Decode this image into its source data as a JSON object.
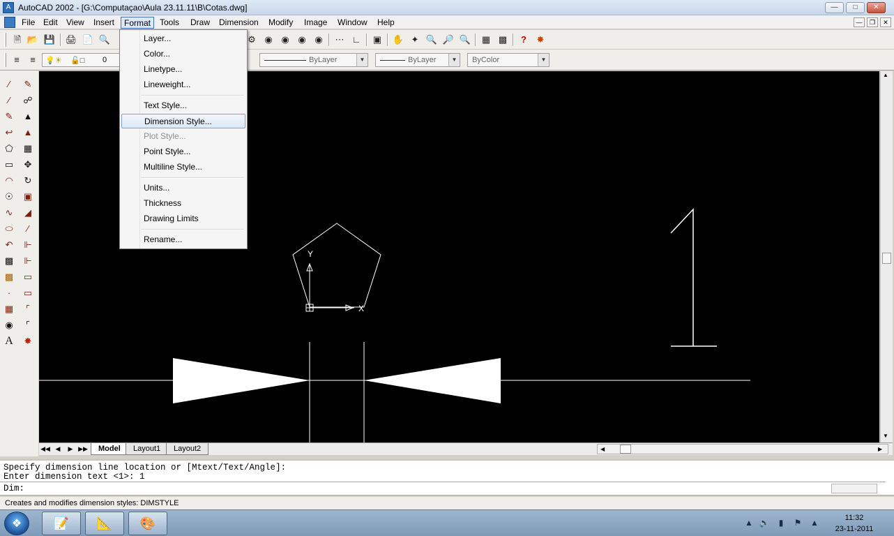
{
  "window": {
    "title": "AutoCAD 2002 - [G:\\Computaçao\\Aula 23.11.11\\B\\Cotas.dwg]",
    "controls": [
      "minimize",
      "maximize",
      "close"
    ]
  },
  "menubar": {
    "items": [
      "File",
      "Edit",
      "View",
      "Insert",
      "Format",
      "Tools",
      "Draw",
      "Dimension",
      "Modify",
      "Image",
      "Window",
      "Help"
    ],
    "active": "Format"
  },
  "format_menu": {
    "items": [
      {
        "label": "Layer...",
        "enabled": true
      },
      {
        "label": "Color...",
        "enabled": true
      },
      {
        "label": "Linetype...",
        "enabled": true
      },
      {
        "label": "Lineweight...",
        "enabled": true
      },
      {
        "label": "Text Style...",
        "enabled": true
      },
      {
        "label": "Dimension Style...",
        "enabled": true,
        "highlighted": true
      },
      {
        "label": "Plot Style...",
        "enabled": false
      },
      {
        "label": "Point Style...",
        "enabled": true
      },
      {
        "label": "Multiline Style...",
        "enabled": true
      },
      {
        "label": "Units...",
        "enabled": true
      },
      {
        "label": "Thickness",
        "enabled": true
      },
      {
        "label": "Drawing Limits",
        "enabled": true
      },
      {
        "label": "Rename...",
        "enabled": true
      }
    ]
  },
  "properties_toolbar": {
    "layer_value": "0",
    "linetype": "ByLayer",
    "lineweight": "ByLayer",
    "plotstyle": "ByColor"
  },
  "drawing": {
    "dimension_text": "1",
    "ucs_x_label": "X",
    "ucs_y_label": "Y"
  },
  "layout_tabs": {
    "tabs": [
      "Model",
      "Layout1",
      "Layout2"
    ],
    "active": "Model"
  },
  "command_line": {
    "history": [
      "Specify dimension line location or [Mtext/Text/Angle]:",
      "Enter dimension text <1>: 1"
    ],
    "prompt": "Dim:"
  },
  "status_bar": {
    "text": "Creates and modifies dimension styles:  DIMSTYLE"
  },
  "taskbar": {
    "time": "11:32",
    "date": "23-11-2011"
  },
  "colors": {
    "canvas": "#000000",
    "geometry": "#ffffff",
    "menu_highlight": "#dce9f8"
  }
}
